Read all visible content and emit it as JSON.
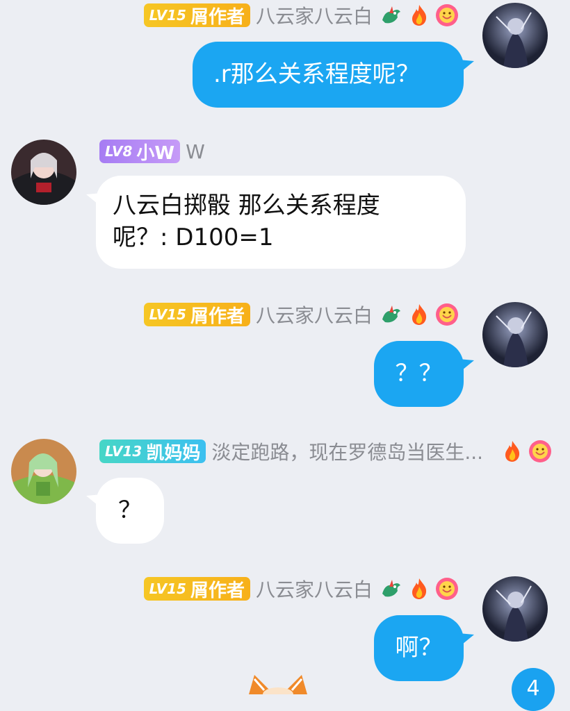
{
  "messages": [
    {
      "side": "right",
      "level": "LV15",
      "title": "屑作者",
      "nickname": "八云家八云白",
      "text": ".r那么关系程度呢？",
      "icons": [
        "dragon-icon",
        "fire-icon",
        "smile-flower-icon"
      ]
    },
    {
      "side": "left",
      "level": "LV8",
      "title": "小W",
      "nickname": "W",
      "text_line1": "八云白掷骰 那么关系程度",
      "text_line2": "呢？: D100=1"
    },
    {
      "side": "right",
      "level": "LV15",
      "title": "屑作者",
      "nickname": "八云家八云白",
      "text": "？？",
      "icons": [
        "dragon-icon",
        "fire-icon",
        "smile-flower-icon"
      ]
    },
    {
      "side": "left",
      "level": "LV13",
      "title": "凯妈妈",
      "nickname": "淡定跑路，现在罗德岛当医生...",
      "text": "？",
      "icons": [
        "fire-icon",
        "smile-flower-icon"
      ]
    },
    {
      "side": "right",
      "level": "LV15",
      "title": "屑作者",
      "nickname": "八云家八云白",
      "text": "啊？",
      "icons": [
        "dragon-icon",
        "fire-icon",
        "smile-flower-icon"
      ]
    }
  ],
  "unread_count": "4",
  "colors": {
    "background": "#eceef3",
    "blue_bubble": "#1ba6f2",
    "gold_badge": "#f6c624",
    "purple_badge": "#b08af5",
    "teal_badge": "#44cfd6"
  }
}
